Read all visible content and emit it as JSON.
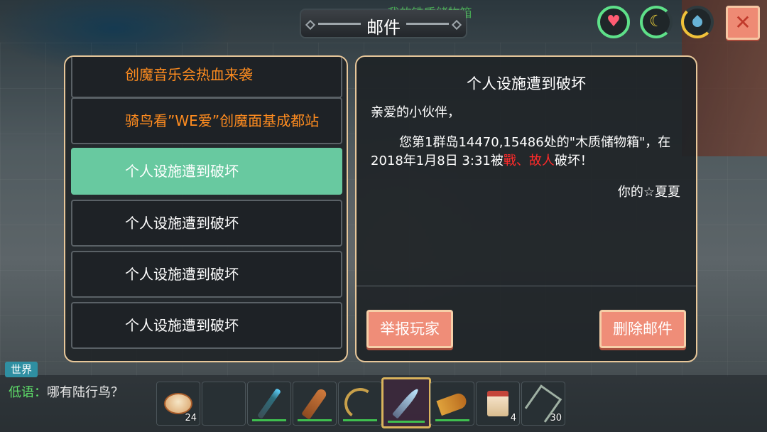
{
  "header": {
    "hint_text": "我的铁质储物箱",
    "title": "邮件"
  },
  "status_rings": {
    "health_icon": "heart-icon",
    "hunger_icon": "banana-icon",
    "water_icon": "water-drop-icon"
  },
  "close_icon": "✕",
  "heart_glyph": "♥",
  "banana_glyph": "☾",
  "mail_list": [
    {
      "subject": "创魔音乐会热血来袭",
      "style": "orange"
    },
    {
      "subject": "骑鸟看”WE爱”创魔面基成都站",
      "style": "orange"
    },
    {
      "subject": "个人设施遭到破坏",
      "style": "selected"
    },
    {
      "subject": "个人设施遭到破坏",
      "style": "normal"
    },
    {
      "subject": "个人设施遭到破坏",
      "style": "normal"
    },
    {
      "subject": "个人设施遭到破坏",
      "style": "normal"
    }
  ],
  "detail": {
    "title": "个人设施遭到破坏",
    "greeting": "亲爱的小伙伴，",
    "body_part1": "您第1群岛14470,15486处的\"木质储物箱\"，在2018年1月8日 3:31被",
    "body_attacker": "戰、故人",
    "body_part2": "破坏！",
    "signature": "你的☆夏夏",
    "report_button": "举报玩家",
    "delete_button": "删除邮件"
  },
  "chat": {
    "channel": "世界",
    "speaker": "低语",
    "separator": "：",
    "message": "哪有陆行鸟？"
  },
  "hotbar": [
    {
      "item": "dumpling-steamer",
      "count": "24"
    },
    {
      "item": "empty",
      "count": ""
    },
    {
      "item": "ice-staff",
      "count": ""
    },
    {
      "item": "wooden-club",
      "count": ""
    },
    {
      "item": "bow",
      "count": ""
    },
    {
      "item": "purple-blade",
      "count": "",
      "selected": true
    },
    {
      "item": "horn",
      "count": ""
    },
    {
      "item": "food-bag",
      "count": "4"
    },
    {
      "item": "trident",
      "count": "30"
    }
  ],
  "colors": {
    "accent_green": "#68c9a0",
    "button_salmon": "#ef8d78",
    "panel_border": "#e7c79a",
    "alert_orange": "#ff8c1f",
    "attacker_red": "#ff2a2a"
  }
}
